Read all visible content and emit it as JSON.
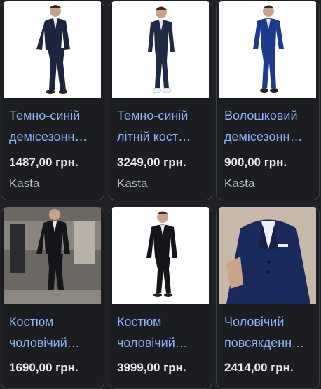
{
  "products": [
    {
      "title_line1": "Темно-синій",
      "title_line2": "демісезонн…",
      "price": "1487,00 грн.",
      "source": "Kasta",
      "image_icon": "navy-suit-photo"
    },
    {
      "title_line1": "Темно-синій",
      "title_line2": "літній кост…",
      "price": "3249,00 грн.",
      "source": "Kasta",
      "image_icon": "navy-suit-photo"
    },
    {
      "title_line1": "Волошковий",
      "title_line2": "демісезонн…",
      "price": "900,00 грн.",
      "source": "Kasta",
      "image_icon": "blue-suit-photo"
    },
    {
      "title_line1": "Костюм",
      "title_line2": "чоловічий…",
      "price": "1690,00 грн.",
      "source": "",
      "image_icon": "black-suit-photo"
    },
    {
      "title_line1": "Костюм",
      "title_line2": "чоловічий…",
      "price": "3999,00 грн.",
      "source": "",
      "image_icon": "black-suit-photo"
    },
    {
      "title_line1": "Чоловічий",
      "title_line2": "повсякденн…",
      "price": "2414,00 грн.",
      "source": "",
      "image_icon": "navy-three-piece-suit-photo"
    }
  ],
  "colors": {
    "background": "#202124",
    "link": "#8ab4f8",
    "price": "#e8eaed",
    "source": "#bdc1c6",
    "navy": "#1b2540",
    "royal_blue": "#1d3b8a",
    "black": "#15161a"
  }
}
